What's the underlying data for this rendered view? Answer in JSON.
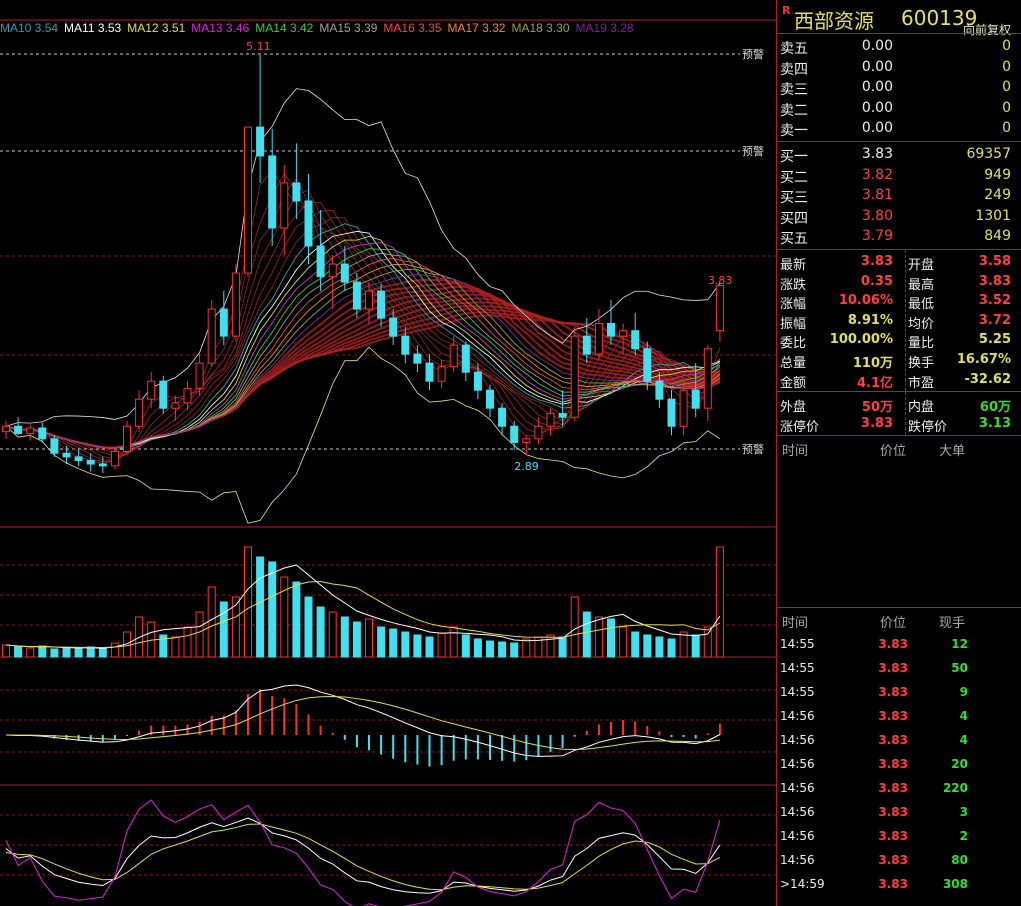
{
  "legend": [
    {
      "label": "MA10 3.54",
      "color": "#30a0b0"
    },
    {
      "label": "MA11 3.53",
      "color": "#ffffff"
    },
    {
      "label": "MA12 3.51",
      "color": "#e0e040"
    },
    {
      "label": "MA13 3.46",
      "color": "#e020e0"
    },
    {
      "label": "MA14 3.42",
      "color": "#30d030"
    },
    {
      "label": "MA15 3.39",
      "color": "#a0a0a0"
    },
    {
      "label": "MA16 3.35",
      "color": "#ff4040"
    },
    {
      "label": "MA17 3.32",
      "color": "#ff8030"
    },
    {
      "label": "MA18 3.30",
      "color": "#a0a030"
    },
    {
      "label": "MA19 3.28",
      "color": "#8020a0"
    }
  ],
  "adjust_label": "向前复权",
  "stock": {
    "badge": "R",
    "name": "西部资源",
    "code": "600139"
  },
  "sell": [
    {
      "label": "卖五",
      "price": "0.00",
      "vol": "0"
    },
    {
      "label": "卖四",
      "price": "0.00",
      "vol": "0"
    },
    {
      "label": "卖三",
      "price": "0.00",
      "vol": "0"
    },
    {
      "label": "卖二",
      "price": "0.00",
      "vol": "0"
    },
    {
      "label": "卖一",
      "price": "0.00",
      "vol": "0"
    }
  ],
  "buy": [
    {
      "label": "买一",
      "price": "3.83",
      "vol": "69357"
    },
    {
      "label": "买二",
      "price": "3.82",
      "vol": "949"
    },
    {
      "label": "买三",
      "price": "3.81",
      "vol": "249"
    },
    {
      "label": "买四",
      "price": "3.80",
      "vol": "1301"
    },
    {
      "label": "买五",
      "price": "3.79",
      "vol": "849"
    }
  ],
  "stats": [
    {
      "l1": "最新",
      "v1": "3.83",
      "c1": "red",
      "l2": "开盘",
      "v2": "3.58",
      "c2": "red"
    },
    {
      "l1": "涨跌",
      "v1": "0.35",
      "c1": "red",
      "l2": "最高",
      "v2": "3.83",
      "c2": "red"
    },
    {
      "l1": "涨幅",
      "v1": "10.06%",
      "c1": "red",
      "l2": "最低",
      "v2": "3.52",
      "c2": "red"
    },
    {
      "l1": "振幅",
      "v1": "8.91%",
      "c1": "yel",
      "l2": "均价",
      "v2": "3.72",
      "c2": "red"
    },
    {
      "l1": "委比",
      "v1": "100.00%",
      "c1": "yel",
      "l2": "量比",
      "v2": "5.25",
      "c2": "yel"
    },
    {
      "l1": "总量",
      "v1": "110万",
      "c1": "yel",
      "l2": "换手",
      "v2": "16.67%",
      "c2": "yel"
    },
    {
      "l1": "金额",
      "v1": "4.1亿",
      "c1": "red",
      "l2": "市盈",
      "v2": "-32.62",
      "c2": "yel"
    }
  ],
  "stats2": [
    {
      "l1": "外盘",
      "v1": "50万",
      "c1": "red",
      "l2": "内盘",
      "v2": "60万",
      "c2": "grn"
    },
    {
      "l1": "涨停价",
      "v1": "3.83",
      "c1": "red",
      "l2": "跌停价",
      "v2": "3.13",
      "c2": "grn"
    }
  ],
  "big_orders": {
    "h_time": "时间",
    "h_price": "价位",
    "h_big": "大单"
  },
  "ticks_header": {
    "h_time": "时间",
    "h_price": "价位",
    "h_vol": "现手"
  },
  "ticks": [
    {
      "time": "14:55",
      "price": "3.83",
      "vol": "12"
    },
    {
      "time": "14:55",
      "price": "3.83",
      "vol": "50"
    },
    {
      "time": "14:55",
      "price": "3.83",
      "vol": "9"
    },
    {
      "time": "14:56",
      "price": "3.83",
      "vol": "4"
    },
    {
      "time": "14:56",
      "price": "3.83",
      "vol": "4"
    },
    {
      "time": "14:56",
      "price": "3.83",
      "vol": "20"
    },
    {
      "time": "14:56",
      "price": "3.83",
      "vol": "220"
    },
    {
      "time": "14:56",
      "price": "3.83",
      "vol": "3"
    },
    {
      "time": "14:56",
      "price": "3.83",
      "vol": "2"
    },
    {
      "time": "14:56",
      "price": "3.83",
      "vol": "80"
    },
    {
      "time": ">14:59",
      "price": "3.83",
      "vol": "308"
    }
  ],
  "chart_data": {
    "type": "candlestick",
    "ylim": [
      2.6,
      5.25
    ],
    "labels": {
      "high": "5.11",
      "low": "2.89",
      "last": "3.83",
      "alert": "预警"
    },
    "alert_levels": [
      5.11,
      4.57,
      2.92
    ],
    "candles": [
      [
        3.02,
        3.08,
        2.98,
        3.05
      ],
      [
        3.05,
        3.1,
        3.0,
        3.01
      ],
      [
        3.01,
        3.06,
        2.97,
        3.04
      ],
      [
        3.04,
        3.07,
        2.96,
        2.98
      ],
      [
        2.98,
        3.0,
        2.88,
        2.9
      ],
      [
        2.9,
        2.94,
        2.84,
        2.88
      ],
      [
        2.88,
        2.92,
        2.83,
        2.86
      ],
      [
        2.86,
        2.9,
        2.8,
        2.84
      ],
      [
        2.84,
        2.88,
        2.79,
        2.83
      ],
      [
        2.83,
        2.93,
        2.81,
        2.91
      ],
      [
        2.91,
        3.08,
        2.9,
        3.05
      ],
      [
        3.05,
        3.25,
        3.02,
        3.2
      ],
      [
        3.2,
        3.35,
        3.15,
        3.3
      ],
      [
        3.3,
        3.33,
        3.12,
        3.15
      ],
      [
        3.15,
        3.22,
        3.08,
        3.18
      ],
      [
        3.18,
        3.3,
        3.14,
        3.26
      ],
      [
        3.26,
        3.45,
        3.22,
        3.4
      ],
      [
        3.4,
        3.75,
        3.38,
        3.7
      ],
      [
        3.7,
        3.8,
        3.5,
        3.55
      ],
      [
        3.55,
        3.95,
        3.52,
        3.9
      ],
      [
        3.9,
        4.71,
        3.88,
        4.71
      ],
      [
        4.71,
        5.11,
        4.4,
        4.55
      ],
      [
        4.55,
        4.7,
        4.05,
        4.15
      ],
      [
        4.15,
        4.5,
        4.0,
        4.4
      ],
      [
        4.4,
        4.62,
        4.2,
        4.3
      ],
      [
        4.3,
        4.45,
        3.95,
        4.05
      ],
      [
        4.05,
        4.25,
        3.8,
        3.88
      ],
      [
        3.88,
        4.0,
        3.7,
        3.95
      ],
      [
        3.95,
        4.05,
        3.8,
        3.85
      ],
      [
        3.85,
        3.9,
        3.65,
        3.7
      ],
      [
        3.7,
        3.85,
        3.62,
        3.8
      ],
      [
        3.8,
        3.84,
        3.6,
        3.65
      ],
      [
        3.65,
        3.7,
        3.5,
        3.55
      ],
      [
        3.55,
        3.6,
        3.4,
        3.45
      ],
      [
        3.45,
        3.5,
        3.35,
        3.4
      ],
      [
        3.4,
        3.45,
        3.25,
        3.3
      ],
      [
        3.3,
        3.42,
        3.26,
        3.38
      ],
      [
        3.38,
        3.55,
        3.35,
        3.5
      ],
      [
        3.5,
        3.52,
        3.3,
        3.35
      ],
      [
        3.35,
        3.4,
        3.2,
        3.25
      ],
      [
        3.25,
        3.28,
        3.1,
        3.15
      ],
      [
        3.15,
        3.18,
        3.0,
        3.05
      ],
      [
        3.05,
        3.08,
        2.92,
        2.96
      ],
      [
        2.96,
        3.0,
        2.89,
        2.98
      ],
      [
        2.98,
        3.1,
        2.95,
        3.05
      ],
      [
        3.05,
        3.15,
        3.0,
        3.12
      ],
      [
        3.12,
        3.25,
        3.05,
        3.1
      ],
      [
        3.1,
        3.6,
        3.08,
        3.55
      ],
      [
        3.55,
        3.65,
        3.4,
        3.45
      ],
      [
        3.45,
        3.7,
        3.42,
        3.62
      ],
      [
        3.62,
        3.75,
        3.5,
        3.55
      ],
      [
        3.55,
        3.62,
        3.45,
        3.58
      ],
      [
        3.58,
        3.68,
        3.44,
        3.48
      ],
      [
        3.48,
        3.52,
        3.25,
        3.3
      ],
      [
        3.3,
        3.35,
        3.15,
        3.2
      ],
      [
        3.2,
        3.25,
        3.0,
        3.05
      ],
      [
        3.05,
        3.3,
        3.0,
        3.25
      ],
      [
        3.25,
        3.4,
        3.1,
        3.15
      ],
      [
        3.15,
        3.5,
        3.08,
        3.48
      ],
      [
        3.58,
        3.83,
        3.52,
        3.83
      ]
    ],
    "volume": [
      12,
      10,
      9,
      11,
      8,
      9,
      8,
      10,
      9,
      14,
      25,
      40,
      35,
      22,
      20,
      30,
      45,
      70,
      55,
      60,
      110,
      100,
      95,
      80,
      75,
      60,
      50,
      45,
      40,
      35,
      38,
      30,
      28,
      25,
      22,
      20,
      24,
      30,
      22,
      18,
      16,
      15,
      14,
      18,
      20,
      22,
      20,
      60,
      45,
      40,
      38,
      30,
      25,
      22,
      20,
      18,
      25,
      22,
      30,
      110
    ],
    "volume_ylim": [
      0,
      120
    ]
  }
}
